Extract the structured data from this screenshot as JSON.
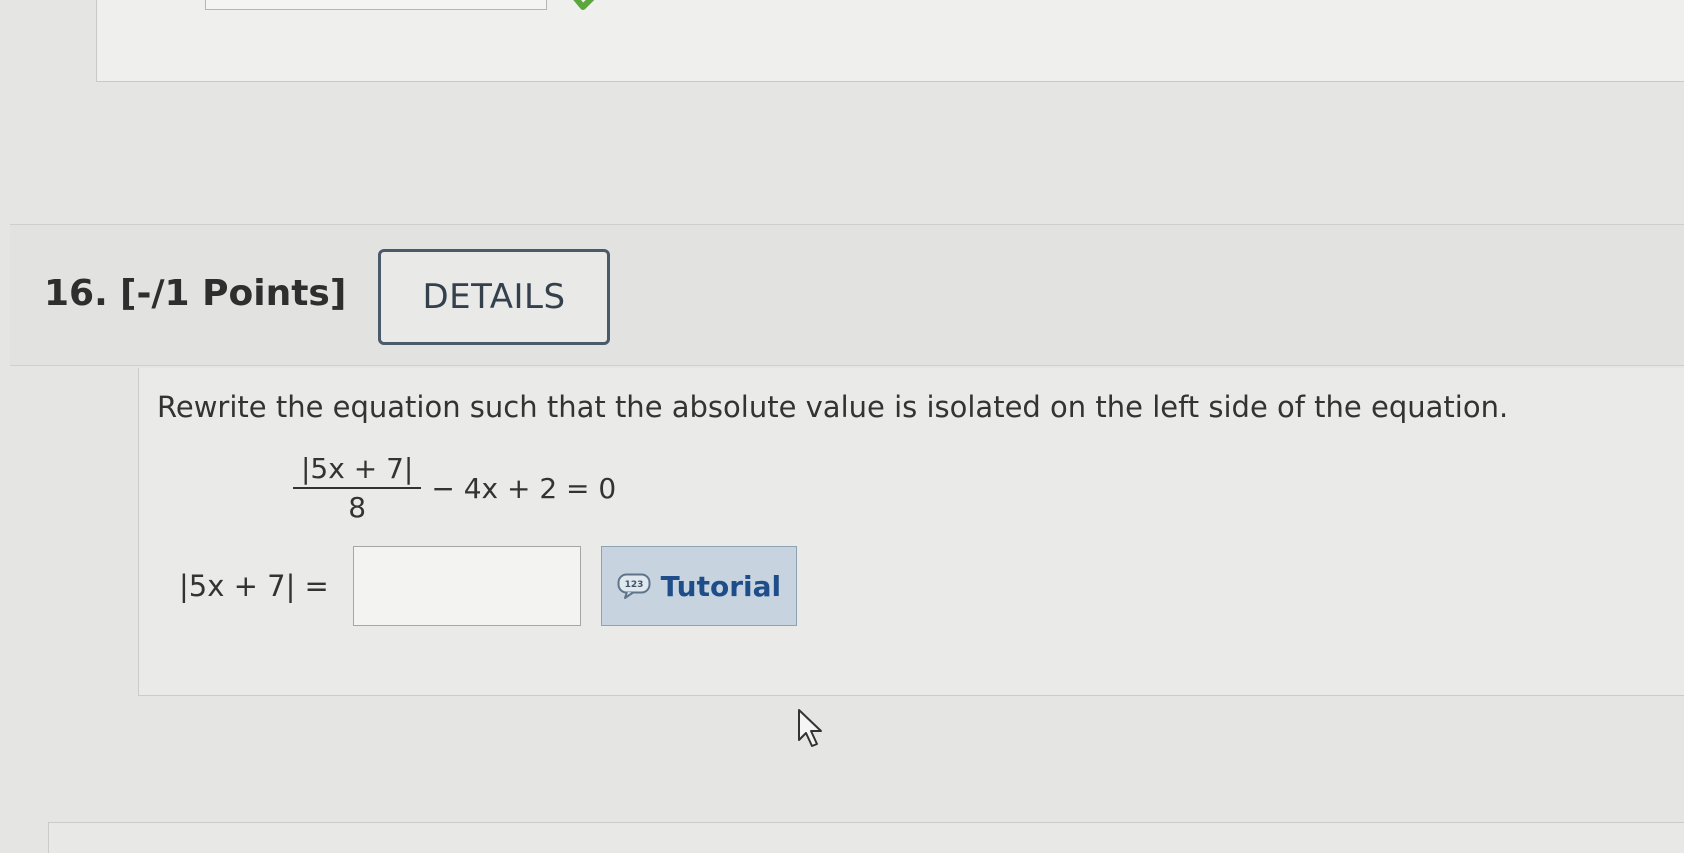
{
  "question": {
    "number": "16.",
    "points": "[-/1 Points]",
    "details_label": "DETAILS",
    "prompt": "Rewrite the equation such that the absolute value is isolated on the left side of the equation.",
    "equation": {
      "numerator": "|5x + 7|",
      "denominator": "8",
      "rest": "− 4x + 2 = 0"
    },
    "answer": {
      "label": "|5x + 7| =",
      "value": "",
      "placeholder": ""
    },
    "tutorial_label": "Tutorial",
    "tutorial_icon_text": "123"
  },
  "colors": {
    "tutorial_text": "#1f4d8a",
    "tutorial_bg": "#c7d4e0",
    "check": "#5aa83c"
  },
  "icons": {
    "check": "check-icon",
    "tutorial": "tutorial-speech-bubble-icon",
    "cursor": "mouse-pointer-icon"
  }
}
